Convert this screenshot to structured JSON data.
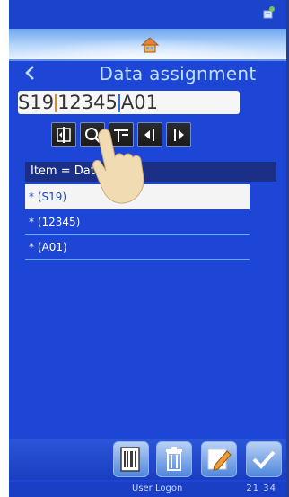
{
  "header": {
    "title": "Data assignment"
  },
  "data_field": {
    "seg1": "S19",
    "seg2": "12345",
    "seg3": "A01"
  },
  "toolbar": {
    "icons": [
      "cursor-jump-icon",
      "search-icon",
      "insert-field-icon",
      "move-left-icon",
      "move-right-icon"
    ]
  },
  "list": {
    "header": "Item = Data",
    "items": [
      "* (S19)",
      "* (12345)",
      "* (A01)"
    ]
  },
  "bottom_bar": {
    "icons": [
      "barcode-icon",
      "trash-icon",
      "edit-icon",
      "check-icon"
    ]
  },
  "footer": {
    "user": "User Logon",
    "time": "21 34"
  },
  "colors": {
    "background": "#1e46d6",
    "accent": "#bfe0ff",
    "selected_row": "#f4f4f4"
  }
}
